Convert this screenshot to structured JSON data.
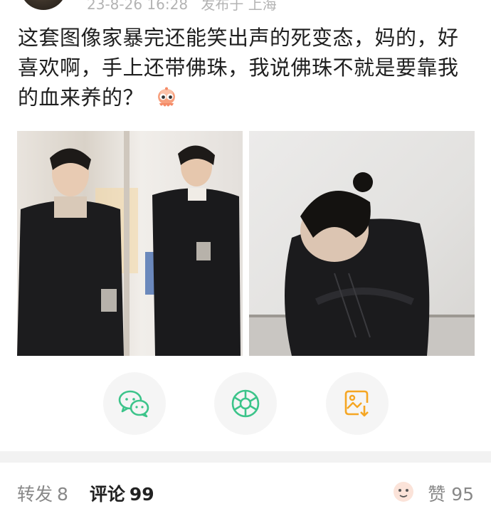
{
  "post": {
    "timestamp": "23-8-26 16:28",
    "location": "发布于 上海",
    "text": "这套图像家暴完还能笑出声的死变态，妈的，好喜欢啊，手上还带佛珠，我说佛珠不就是要靠我的血来养的？",
    "emoji": "cute-octopus-emoji"
  },
  "share": {
    "wechat_icon": "wechat-icon",
    "moments_icon": "moments-icon",
    "save_image_icon": "save-image-icon",
    "colors": {
      "wechat": "#3cc48a",
      "moments": "#3cc48a",
      "save": "#f5a623"
    }
  },
  "tabs": [
    {
      "label": "转发",
      "count": "8"
    },
    {
      "label": "评论",
      "count": "99"
    }
  ],
  "like": {
    "label": "赞",
    "count": "95"
  }
}
